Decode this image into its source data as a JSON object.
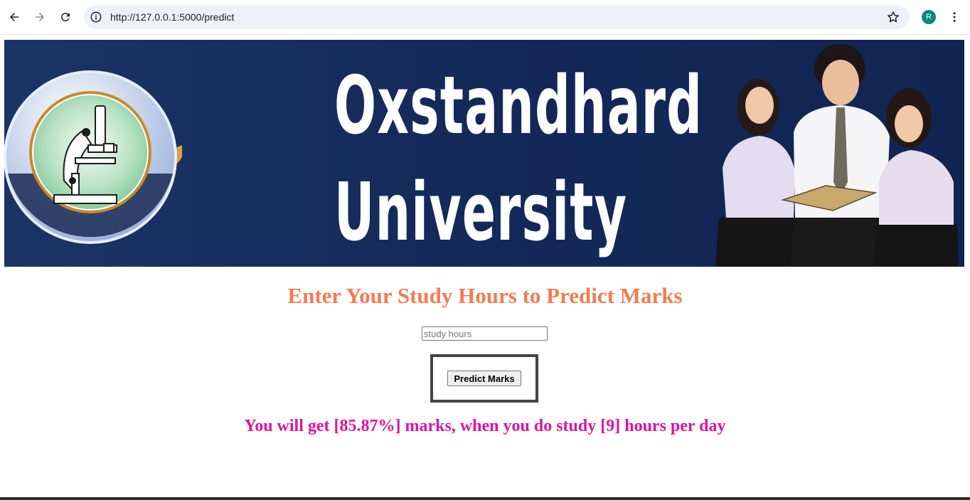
{
  "browser": {
    "url": "http://127.0.0.1:5000/predict",
    "profile_initial": "R",
    "profile_color": "#0b8a73"
  },
  "banner": {
    "title_line1": "Oxstandhard",
    "title_line2": "University",
    "background_color": "#13295a"
  },
  "form": {
    "heading": "Enter Your Study Hours to Predict Marks",
    "heading_color": "#f47b51",
    "input_placeholder": "study hours",
    "input_value": "",
    "button_label": "Predict Marks"
  },
  "result": {
    "text": "You will get [85.87%] marks, when you do study [9] hours per day",
    "color": "#e0129f"
  }
}
